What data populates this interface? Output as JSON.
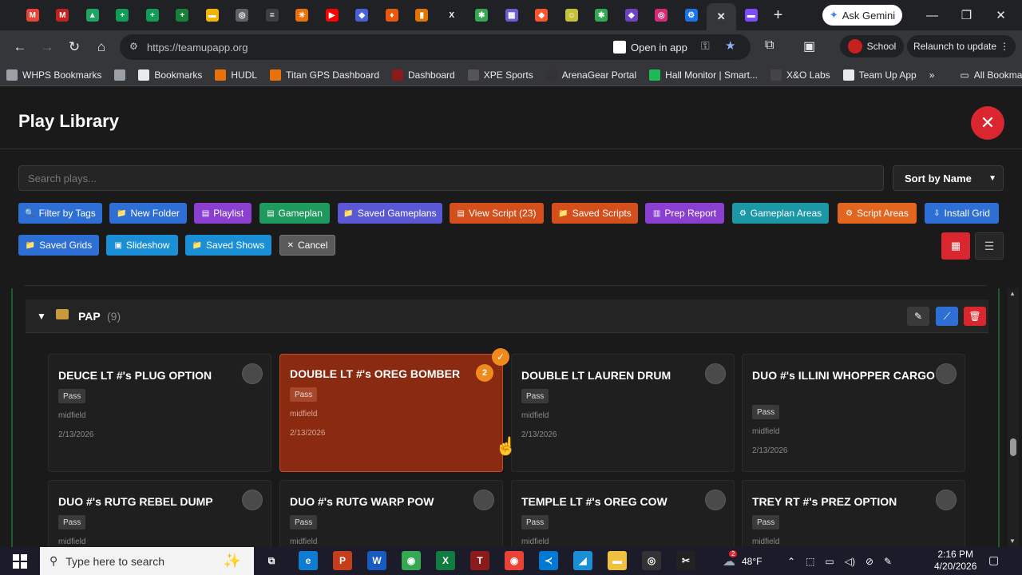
{
  "browser": {
    "tab_favicons": [
      {
        "name": "gmail-icon",
        "glyph": "M",
        "color": "#ea4335"
      },
      {
        "name": "gmail-icon",
        "glyph": "M",
        "color": "#c5221f"
      },
      {
        "name": "drive-icon",
        "glyph": "▲",
        "color": "#1fa463"
      },
      {
        "name": "sheets-icon",
        "glyph": "+",
        "color": "#0f9d58"
      },
      {
        "name": "sheets-icon",
        "glyph": "+",
        "color": "#0f9d58"
      },
      {
        "name": "classroom-icon",
        "glyph": "+",
        "color": "#188038"
      },
      {
        "name": "slides-icon",
        "glyph": "▬",
        "color": "#f4b400"
      },
      {
        "name": "circle-icon",
        "glyph": "◎",
        "color": "#5f6368"
      },
      {
        "name": "dash-icon",
        "glyph": "=",
        "color": "#3c4043"
      },
      {
        "name": "asterisk-icon",
        "glyph": "✳",
        "color": "#e8710a"
      },
      {
        "name": "youtube-icon",
        "glyph": "▶",
        "color": "#ff0000"
      },
      {
        "name": "shield-icon",
        "glyph": "◆",
        "color": "#4a5fd8"
      },
      {
        "name": "flame-icon",
        "glyph": "♦",
        "color": "#e8590c"
      },
      {
        "name": "bars-icon",
        "glyph": "▮",
        "color": "#e37400"
      },
      {
        "name": "x-icon",
        "glyph": "X",
        "color": "#202124"
      },
      {
        "name": "sparkle-icon",
        "glyph": "✱",
        "color": "#34a853"
      },
      {
        "name": "grid-icon",
        "glyph": "▦",
        "color": "#6e5bd8"
      },
      {
        "name": "brave-icon",
        "glyph": "◆",
        "color": "#fb542b"
      },
      {
        "name": "smiley-icon",
        "glyph": "☺",
        "color": "#c6c13a"
      },
      {
        "name": "sparkle-icon",
        "glyph": "✱",
        "color": "#34a853"
      },
      {
        "name": "shield-icon",
        "glyph": "◆",
        "color": "#6f42c1"
      },
      {
        "name": "instagram-icon",
        "glyph": "◎",
        "color": "#d62976"
      },
      {
        "name": "settings-icon",
        "glyph": "⚙",
        "color": "#1a73e8"
      }
    ],
    "active_tab_close": "✕",
    "next_tab_favicon": {
      "name": "chat-icon",
      "glyph": "▬",
      "color": "#7c4dff"
    },
    "new_tab": "+",
    "ask_gemini": "Ask Gemini",
    "window": {
      "minimize": "—",
      "restore": "❐",
      "close": "✕"
    },
    "url": "https://teamupapp.org",
    "open_in_app": "Open in app",
    "profile": "School",
    "relaunch": "Relaunch to update",
    "bookmarks": [
      {
        "label": "WHPS Bookmarks",
        "icon": "folder-icon",
        "color": "#9aa0a6"
      },
      {
        "label": "",
        "icon": "apps-icon",
        "color": "#9aa0a6"
      },
      {
        "label": "Bookmarks",
        "icon": "star-icon",
        "color": "#e8eaed"
      },
      {
        "label": "HUDL",
        "icon": "shield-icon",
        "color": "#e8710a"
      },
      {
        "label": "Titan GPS Dashboard",
        "icon": "shield-icon",
        "color": "#e8710a"
      },
      {
        "label": "Dashboard",
        "icon": "dashboard-icon",
        "color": "#8b1a1a"
      },
      {
        "label": "XPE Sports",
        "icon": "dash-icon",
        "color": "#555"
      },
      {
        "label": "ArenaGear Portal",
        "icon": "ball-icon",
        "color": "#333"
      },
      {
        "label": "Hall Monitor | Smart...",
        "icon": "arrow-icon",
        "color": "#1db954"
      },
      {
        "label": "X&O Labs",
        "icon": "xo-icon",
        "color": "#444"
      },
      {
        "label": "Team Up App",
        "icon": "teamup-icon",
        "color": "#e8eaed"
      }
    ],
    "more_bookmarks": "»",
    "all_bookmarks": "All Bookmarks"
  },
  "app": {
    "title": "Play Library",
    "search_placeholder": "Search plays...",
    "sort_label": "Sort by Name",
    "toolbar_row1": [
      {
        "label": "Filter by Tags",
        "icon": "search-icon",
        "glyph": "🔍",
        "color": "#2d6fd4"
      },
      {
        "label": "New Folder",
        "icon": "folder-icon",
        "glyph": "📁",
        "color": "#2d6fd4"
      },
      {
        "label": "Playlist",
        "icon": "playlist-icon",
        "glyph": "▤",
        "color": "#8a3fd1"
      },
      {
        "label": "Gameplan",
        "icon": "document-icon",
        "glyph": "▤",
        "color": "#1f9a5e"
      },
      {
        "label": "Saved Gameplans",
        "icon": "folder-icon",
        "glyph": "📁",
        "color": "#5b58d6"
      },
      {
        "label": "View Script (23)",
        "icon": "document-icon",
        "glyph": "▤",
        "color": "#d44f1c"
      },
      {
        "label": "Saved Scripts",
        "icon": "folder-icon",
        "glyph": "📁",
        "color": "#d44f1c"
      },
      {
        "label": "Prep Report",
        "icon": "report-icon",
        "glyph": "▥",
        "color": "#8a3fd1"
      },
      {
        "label": "Gameplan Areas",
        "icon": "gear-icon",
        "glyph": "⚙",
        "color": "#1b97a6"
      },
      {
        "label": "Script Areas",
        "icon": "gear-icon",
        "glyph": "⚙",
        "color": "#e2661f"
      },
      {
        "label": "Install Grid",
        "icon": "install-icon",
        "glyph": "⇩",
        "color": "#2d6fd4"
      }
    ],
    "toolbar_row2": [
      {
        "label": "Saved Grids",
        "icon": "folder-icon",
        "glyph": "📁",
        "color": "#2d6fd4"
      },
      {
        "label": "Slideshow",
        "icon": "slideshow-icon",
        "glyph": "▣",
        "color": "#1a8fd6"
      },
      {
        "label": "Saved Shows",
        "icon": "folder-icon",
        "glyph": "📁",
        "color": "#1a8fd6"
      },
      {
        "label": "Cancel",
        "icon": "close-icon",
        "glyph": "✕",
        "color": "#5a5a5a"
      }
    ],
    "view_grid_color": "#d9262f",
    "folder": {
      "name": "PAP",
      "count": "(9)",
      "actions": [
        {
          "name": "edit-icon",
          "glyph": "✎",
          "color": "#3a3a3a"
        },
        {
          "name": "rename-icon",
          "glyph": "⟋",
          "color": "#2d6fd4"
        },
        {
          "name": "delete-icon",
          "glyph": "🗑",
          "color": "#d9262f"
        }
      ]
    },
    "plays": [
      {
        "title": "DEUCE LT #'s PLUG OPTION",
        "tag": "Pass",
        "zone": "midfield",
        "date": "2/13/2026",
        "selected": false
      },
      {
        "title": "DOUBLE LT #'s OREG BOMBER",
        "tag": "Pass",
        "zone": "midfield",
        "date": "2/13/2026",
        "selected": true,
        "order": "2",
        "check": "✓"
      },
      {
        "title": "DOUBLE LT LAUREN DRUM",
        "tag": "Pass",
        "zone": "midfield",
        "date": "2/13/2026",
        "selected": false
      },
      {
        "title": "DUO #'s ILLINI WHOPPER CARGO",
        "tag": "Pass",
        "zone": "midfield",
        "date": "2/13/2026",
        "selected": false
      },
      {
        "title": "DUO #'s RUTG REBEL DUMP",
        "tag": "Pass",
        "zone": "midfield",
        "date": "",
        "selected": false
      },
      {
        "title": "DUO #'s RUTG WARP POW",
        "tag": "Pass",
        "zone": "midfield",
        "date": "",
        "selected": false
      },
      {
        "title": "TEMPLE LT #'s OREG COW",
        "tag": "Pass",
        "zone": "midfield",
        "date": "",
        "selected": false
      },
      {
        "title": "TREY RT #'s PREZ OPTION",
        "tag": "Pass",
        "zone": "midfield",
        "date": "",
        "selected": false
      }
    ]
  },
  "taskbar": {
    "search_placeholder": "Type here to search",
    "weather": "48°F",
    "time": "2:16 PM",
    "date": "4/20/2026",
    "notification_badge": "2",
    "apps": [
      {
        "name": "task-view-icon",
        "glyph": "⧉",
        "color": "#1b1b2a"
      },
      {
        "name": "edge-icon",
        "glyph": "e",
        "color": "#0f7bd1"
      },
      {
        "name": "powerpoint-icon",
        "glyph": "P",
        "color": "#c43e1c"
      },
      {
        "name": "word-icon",
        "glyph": "W",
        "color": "#185abd"
      },
      {
        "name": "chrome-icon",
        "glyph": "◉",
        "color": "#34a853"
      },
      {
        "name": "excel-icon",
        "glyph": "X",
        "color": "#107c41"
      },
      {
        "name": "app-icon",
        "glyph": "T",
        "color": "#8b1a1a"
      },
      {
        "name": "chrome-icon",
        "glyph": "◉",
        "color": "#ea4335"
      },
      {
        "name": "vscode-icon",
        "glyph": "≺",
        "color": "#0078d4"
      },
      {
        "name": "app-icon",
        "glyph": "◢",
        "color": "#1a8fd6"
      },
      {
        "name": "file-explorer-icon",
        "glyph": "▬",
        "color": "#f0c040"
      },
      {
        "name": "obs-icon",
        "glyph": "◎",
        "color": "#333"
      },
      {
        "name": "capcut-icon",
        "glyph": "✂",
        "color": "#222"
      }
    ]
  }
}
